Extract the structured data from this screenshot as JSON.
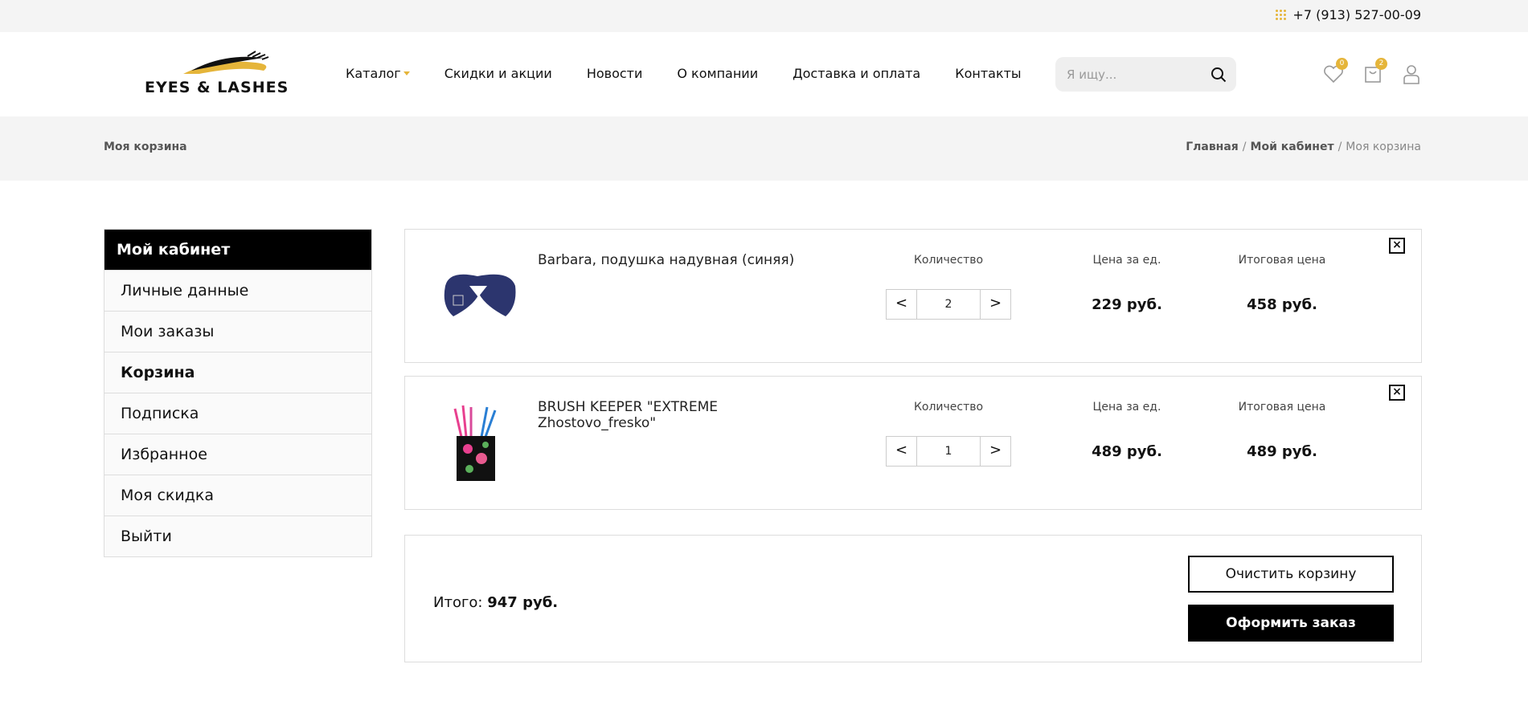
{
  "topbar": {
    "phone": "+7 (913) 527-00-09"
  },
  "header": {
    "logo_text": "EYES & LASHES",
    "nav": [
      {
        "label": "Каталог"
      },
      {
        "label": "Скидки и акции"
      },
      {
        "label": "Новости"
      },
      {
        "label": "О компании"
      },
      {
        "label": "Доставка и оплата"
      },
      {
        "label": "Контакты"
      }
    ],
    "search": {
      "placeholder": "Я ищу..."
    },
    "wishlist_count": "0",
    "cart_count": "2"
  },
  "breadcrumb": {
    "page_title": "Моя корзина",
    "items": [
      "Главная",
      "Мой кабинет",
      "Моя корзина"
    ],
    "separator": "/"
  },
  "sidebar": {
    "title": "Мой кабинет",
    "items": [
      {
        "label": "Личные данные"
      },
      {
        "label": "Мои заказы"
      },
      {
        "label": "Корзина"
      },
      {
        "label": "Подписка"
      },
      {
        "label": "Избранное"
      },
      {
        "label": "Моя скидка"
      },
      {
        "label": "Выйти"
      }
    ]
  },
  "cart": {
    "labels": {
      "quantity": "Количество",
      "unit_price": "Цена за ед.",
      "total_price": "Итоговая цена"
    },
    "items": [
      {
        "name": "Barbara, подушка надувная (синяя)",
        "quantity": "2",
        "unit_price": "229 руб.",
        "total_price": "458 руб."
      },
      {
        "name": "BRUSH KEEPER \"EXTREME Zhostovo_fresko\"",
        "quantity": "1",
        "unit_price": "489 руб.",
        "total_price": "489 руб."
      }
    ],
    "total_label": "Итого:",
    "total_value": "947 руб.",
    "clear_label": "Очистить корзину",
    "order_label": "Оформить заказ"
  },
  "colors": {
    "accent": "#e5b53a",
    "dark": "#000000",
    "band": "#f4f4f4"
  }
}
